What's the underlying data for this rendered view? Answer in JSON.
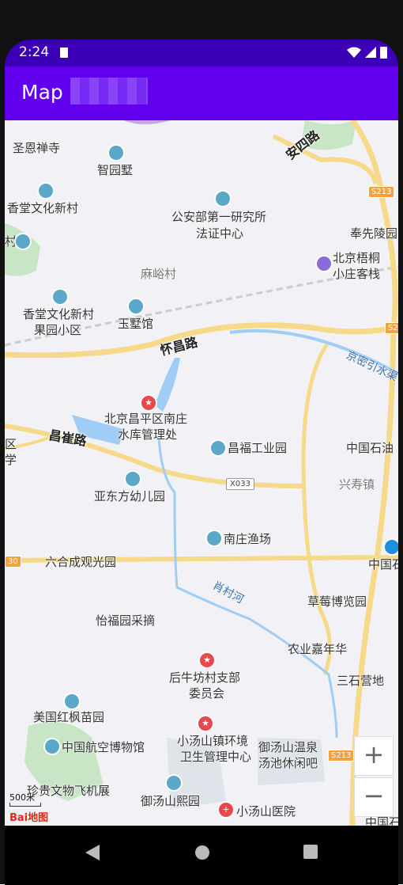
{
  "status_bar": {
    "time": "2:24"
  },
  "app_bar": {
    "title": "Map"
  },
  "map": {
    "places": [
      "圣恩禅寺",
      "智园墅",
      "香堂文化新村",
      "公安部第一研究所",
      "法证中心",
      "奉先陵园",
      "麻峪村",
      "北京梧桐",
      "小庄客栈",
      "香堂文化新村",
      "果园小区",
      "玉墅馆",
      "北京昌平区南庄",
      "水库管理处",
      "昌福工业园",
      "中国石油",
      "兴寿镇",
      "亚东方幼儿园",
      "南庄渔场",
      "六合成观光园",
      "中国石",
      "草莓博览园",
      "怡福园采摘",
      "农业嘉年华",
      "后牛坊村支部",
      "委员会",
      "三石营地",
      "美国红枫苗园",
      "小汤山镇环境",
      "卫生管理中心",
      "中国航空博物馆",
      "御汤山温泉",
      "汤池休闲吧",
      "珍贵文物飞机展",
      "御汤山熙园",
      "小汤山医院",
      "中国石",
      "区",
      "学",
      "村"
    ],
    "roads": [
      "安四路",
      "怀昌路",
      "昌崔路"
    ],
    "rivers": [
      "京密引水渠",
      "肖村河"
    ],
    "shields": [
      "S213",
      "S21",
      "S213",
      "30"
    ],
    "county_road": "X033",
    "scale_label": "500米",
    "logo_text": "Bai地图",
    "zoom_in": "+",
    "zoom_out": "−"
  }
}
